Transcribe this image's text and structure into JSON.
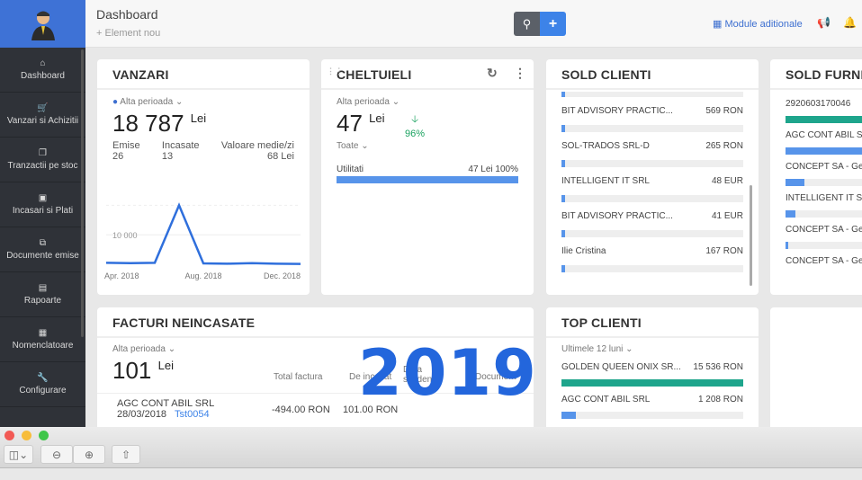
{
  "sidebar": {
    "items": [
      {
        "label": "Dashboard",
        "icon": "home-icon"
      },
      {
        "label": "Vanzari si Achizitii",
        "icon": "cart-icon"
      },
      {
        "label": "Tranzactii pe stoc",
        "icon": "copy-icon"
      },
      {
        "label": "Incasari si Plati",
        "icon": "money-icon"
      },
      {
        "label": "Documente emise",
        "icon": "documents-icon"
      },
      {
        "label": "Rapoarte",
        "icon": "bar-chart-icon"
      },
      {
        "label": "Nomenclatoare",
        "icon": "calendar-icon"
      },
      {
        "label": "Configurare",
        "icon": "wrench-icon"
      }
    ]
  },
  "header": {
    "title": "Dashboard",
    "new_element": "+ Element nou",
    "modules": "Module aditionale"
  },
  "vanzari": {
    "title": "VANZARI",
    "period": "Alta perioada",
    "total": "18 787",
    "currency": "Lei",
    "emise_label": "Emise",
    "emise": "26",
    "incasate_label": "Incasate",
    "incasate": "13",
    "medie_label": "Valoare medie/zi",
    "medie": "68 Lei"
  },
  "chart_data": {
    "type": "line",
    "x": [
      "Apr. 2018",
      "May 2018",
      "Jun. 2018",
      "Jul. 2018",
      "Aug. 2018",
      "Sep. 2018",
      "Oct. 2018",
      "Nov. 2018",
      "Dec. 2018"
    ],
    "values": [
      500,
      400,
      500,
      20000,
      300,
      200,
      400,
      200,
      100
    ],
    "tick_labels_x": [
      "Apr. 2018",
      "Aug. 2018",
      "Dec. 2018"
    ],
    "tick_labels_y": [
      "10 000"
    ],
    "ylim": [
      0,
      25000
    ],
    "grid": true,
    "color": "#2f6fdc"
  },
  "cheltuieli": {
    "title": "CHELTUIELI",
    "period": "Alta perioada",
    "total": "47",
    "currency": "Lei",
    "change": "96%",
    "filter": "Toate",
    "category": "Utilitati",
    "category_value": "47 Lei",
    "category_pct": "100%",
    "category_fill": 1.0
  },
  "sold_clienti": {
    "title": "SOLD CLIENTI",
    "items": [
      {
        "name": "BIT ADVISORY PRACTIC...",
        "value": "569 RON",
        "fill": 0.01
      },
      {
        "name": "SOL-TRADOS SRL-D",
        "value": "265 RON",
        "fill": 0.01
      },
      {
        "name": "INTELLIGENT IT SRL",
        "value": "48 EUR",
        "fill": 0.01
      },
      {
        "name": "BIT ADVISORY PRACTIC...",
        "value": "41 EUR",
        "fill": 0.01
      },
      {
        "name": "Ilie Cristina",
        "value": "167 RON",
        "fill": 0.01
      }
    ]
  },
  "sold_furnizori": {
    "title": "SOLD FURNIZ",
    "items": [
      {
        "name": "2920603170046",
        "fill": 1.0,
        "color": "#1ea58c"
      },
      {
        "name": "AGC CONT ABIL SRL",
        "fill": 0.9,
        "color": "#5794ea"
      },
      {
        "name": "CONCEPT SA - Gest",
        "fill": 0.2,
        "color": "#5794ea"
      },
      {
        "name": "INTELLIGENT IT SRL",
        "fill": 0.1,
        "color": "#5794ea"
      },
      {
        "name": "CONCEPT SA - Gest",
        "fill": 0.03,
        "color": "#5794ea"
      },
      {
        "name": "CONCEPT SA - Gest",
        "fill": 0,
        "color": "#5794ea"
      }
    ]
  },
  "facturi": {
    "title": "FACTURI NEINCASATE",
    "period": "Alta perioada",
    "total": "101",
    "currency": "Lei",
    "columns": [
      "Total factura",
      "De incasat",
      "Data scadenta",
      "Document"
    ],
    "rows": [
      {
        "client": "AGC CONT ABIL SRL",
        "date": "28/03/2018",
        "doc": "Tst0054",
        "total": "-494.00 RON",
        "de_incasat": "101.00 RON"
      }
    ]
  },
  "top_clienti": {
    "title": "TOP CLIENTI",
    "period": "Ultimele 12 luni",
    "items": [
      {
        "name": "GOLDEN QUEEN ONIX SR...",
        "value": "15 536 RON",
        "fill": 1.0,
        "color": "#1ea58c"
      },
      {
        "name": "AGC CONT ABIL SRL",
        "value": "1 208 RON",
        "fill": 0.08,
        "color": "#5794ea"
      }
    ]
  },
  "overlay": "2019"
}
